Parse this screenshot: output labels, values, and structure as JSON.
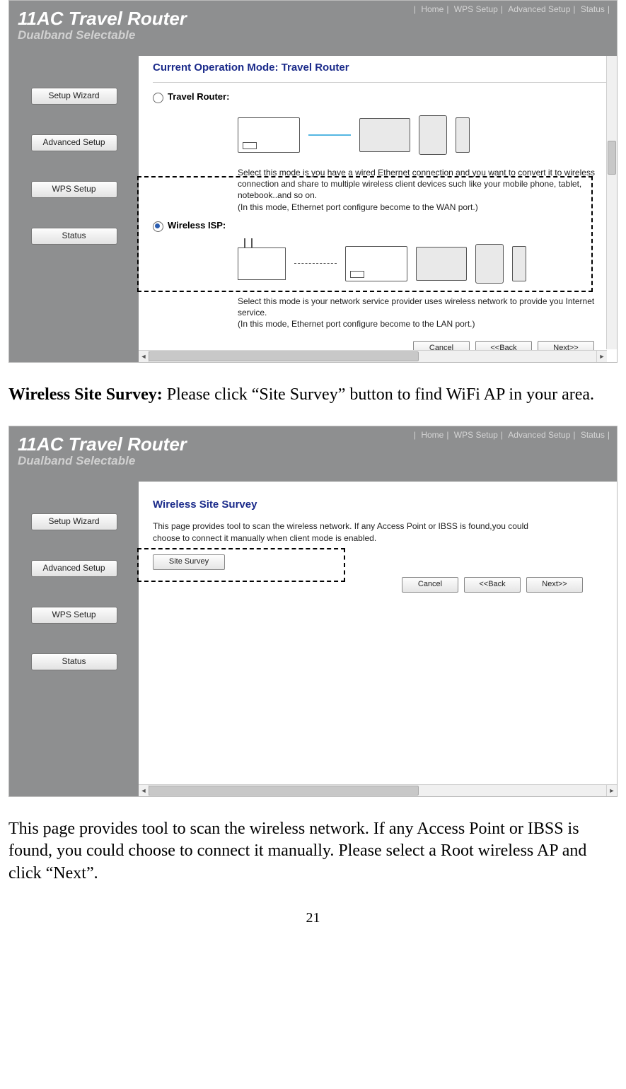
{
  "brand": {
    "title": "11AC Travel Router",
    "subtitle": "Dualband Selectable"
  },
  "topnav": {
    "sep": " | ",
    "items": [
      "Home",
      "WPS Setup",
      "Advanced Setup",
      "Status"
    ]
  },
  "sidebar": {
    "items": [
      "Setup Wizard",
      "Advanced Setup",
      "WPS Setup",
      "Status"
    ]
  },
  "screen1": {
    "title": "Current Operation Mode: Travel Router",
    "mode1": {
      "label": "Travel Router:",
      "desc1": "Select this mode is you have a wired Ethernet connection and you want to convert it to wireless connection and share to multiple wireless client devices such like your mobile phone, tablet, notebook..and so on.",
      "desc2": "(In this mode, Ethernet port configure become to the WAN port.)"
    },
    "mode2": {
      "label": "Wireless ISP:",
      "desc1": "Select this mode is your network service provider uses wireless network to provide you Internet service.",
      "desc2": "(In this mode, Ethernet port configure become to the LAN port.)"
    },
    "btn_cancel": "Cancel",
    "btn_back": "<<Back",
    "btn_next": "Next>>"
  },
  "doc1": {
    "bold": "Wireless Site Survey: ",
    "rest": "Please click “Site Survey” button to find WiFi AP in your area."
  },
  "screen2": {
    "title": "Wireless Site Survey",
    "desc": "This page provides tool to scan the wireless network. If any Access Point or IBSS is found,you could choose to connect it manually when client mode is enabled.",
    "btn_survey": "Site Survey",
    "btn_cancel": "Cancel",
    "btn_back": "<<Back",
    "btn_next": "Next>>"
  },
  "doc2": "This page provides tool to scan the wireless network. If any Access Point or IBSS is found, you could choose to connect it manually. Please select a Root wireless AP and click “Next”.",
  "page_number": "21"
}
